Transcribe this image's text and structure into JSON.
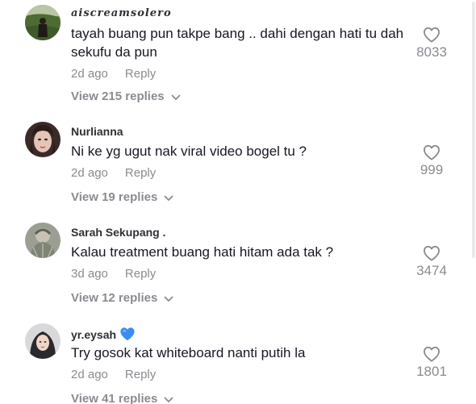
{
  "comments": [
    {
      "username": "aiscreamsolero",
      "text": "tayah buang pun takpe bang .. dahi dengan hati tu dah sekufu da pun",
      "time": "2d ago",
      "reply_label": "Reply",
      "likes": "8033",
      "view_replies": "View 215 replies"
    },
    {
      "username": "Nurlianna",
      "text": "Ni ke yg ugut nak viral video bogel tu ?",
      "time": "2d ago",
      "reply_label": "Reply",
      "likes": "999",
      "view_replies": "View 19 replies"
    },
    {
      "username": "Sarah Sekupang .",
      "text": "Kalau treatment buang hati hitam ada tak ?",
      "time": "3d ago",
      "reply_label": "Reply",
      "likes": "3474",
      "view_replies": "View 12 replies"
    },
    {
      "username": "yr.eysah",
      "text": "Try gosok kat whiteboard nanti putih la",
      "time": "2d ago",
      "reply_label": "Reply",
      "likes": "1801",
      "view_replies": "View 41 replies"
    }
  ],
  "icons": {
    "like": "heart-outline-icon",
    "expand": "chevron-down-icon",
    "emoji": "blue-heart-emoji"
  },
  "colors": {
    "primary_text": "#161823",
    "secondary_text": "#8a8b91",
    "emoji_blue": "#3b8ef0"
  }
}
